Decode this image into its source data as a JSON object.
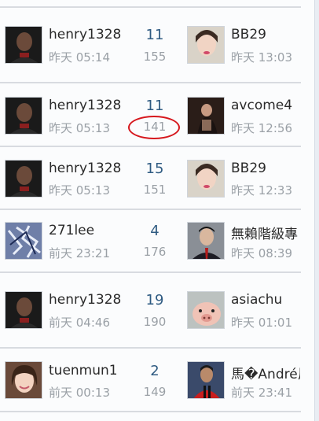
{
  "rows": [
    {
      "poster": {
        "name": "henry1328",
        "time": "昨天 05:14",
        "avatar": "man-dark-avatar"
      },
      "replies": "11",
      "views": "155",
      "last": {
        "name": "BB29",
        "time": "昨天 13:03",
        "avatar": "woman-portrait-avatar"
      }
    },
    {
      "poster": {
        "name": "henry1328",
        "time": "昨天 05:13",
        "avatar": "man-dark-avatar"
      },
      "replies": "11",
      "views": "141",
      "last": {
        "name": "avcome4",
        "time": "昨天 12:56",
        "avatar": "woman-dark-photo-avatar"
      }
    },
    {
      "poster": {
        "name": "henry1328",
        "time": "昨天 05:13",
        "avatar": "man-dark-avatar"
      },
      "replies": "15",
      "views": "151",
      "last": {
        "name": "BB29",
        "time": "昨天 12:33",
        "avatar": "woman-portrait-avatar"
      }
    },
    {
      "poster": {
        "name": "271lee",
        "time": "前天 23:21",
        "avatar": "abstract-scribble-avatar"
      },
      "replies": "4",
      "views": "176",
      "last": {
        "name": "無賴階級專",
        "time": "昨天 08:39",
        "avatar": "man-suit-avatar"
      }
    },
    {
      "poster": {
        "name": "henry1328",
        "time": "前天 04:46",
        "avatar": "man-dark-avatar"
      },
      "replies": "19",
      "views": "190",
      "last": {
        "name": "asiachu",
        "time": "昨天 01:01",
        "avatar": "piglet-avatar"
      }
    },
    {
      "poster": {
        "name": "tuenmun1",
        "time": "前天 00:13",
        "avatar": "woman-smiling-avatar"
      },
      "replies": "2",
      "views": "149",
      "last": {
        "name": "馬�André尼",
        "time": "前天 23:41",
        "avatar": "footballer-red-avatar"
      }
    }
  ],
  "colors": {
    "name": "#2a2a2a",
    "time": "#9aa0a6",
    "replies": "#2f5b82",
    "highlight_circle": "#d6161c"
  }
}
